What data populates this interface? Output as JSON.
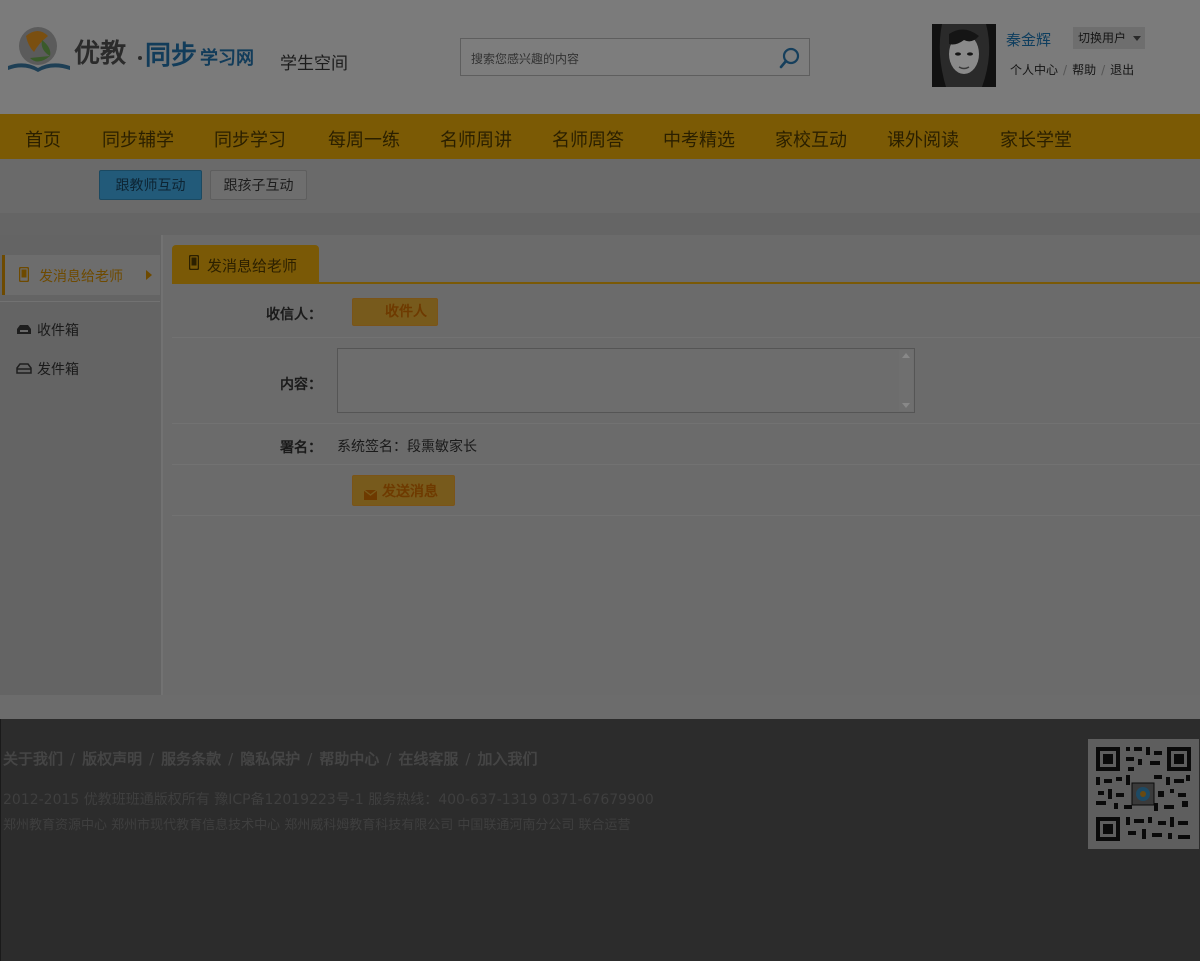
{
  "header": {
    "logo_text": "优教·同步学习网",
    "site_section": "学生空间",
    "search": {
      "placeholder": "搜索您感兴趣的内容",
      "button_icon": "search-icon"
    },
    "user": {
      "name": "秦金辉",
      "switch_label": "切换用户",
      "links": [
        "个人中心",
        "帮助",
        "退出"
      ]
    }
  },
  "nav": {
    "items": [
      "首页",
      "同步辅学",
      "同步学习",
      "每周一练",
      "名师周讲",
      "名师周答",
      "中考精选",
      "家校互动",
      "课外阅读",
      "家长学堂"
    ],
    "active_index": 7
  },
  "subnav": {
    "items": [
      "跟教师互动",
      "跟孩子互动"
    ],
    "active_index": 0
  },
  "sidebar": {
    "active_item": {
      "label": "发消息给老师",
      "icon": "phone-icon"
    },
    "items": [
      {
        "label": "收件箱",
        "icon": "inbox-icon"
      },
      {
        "label": "发件箱",
        "icon": "outbox-icon"
      }
    ]
  },
  "main": {
    "tab_label": "发消息给老师",
    "form": {
      "recipient_label": "收信人：",
      "recipient_button": "收件人",
      "content_label": "内容：",
      "content_value": "",
      "signature_label": "署名：",
      "signature_value": "系统签名：段熏敏家长",
      "send_button": "发送消息"
    }
  },
  "footer": {
    "links": [
      "关于我们",
      "版权声明",
      "服务条款",
      "隐私保护",
      "帮助中心",
      "在线客服",
      "加入我们"
    ],
    "copyright": "2012-2015 优教班班通版权所有  豫ICP备12019223号-1     服务热线：400-637-1319    0371-67679900",
    "operators": "郑州教育资源中心    郑州市现代教育信息技术中心   郑州威科姆教育科技有限公司 中国联通河南分公司  联合运营"
  },
  "colors": {
    "nav_bg": "#7b5a05",
    "accent_orange": "#6e4a00",
    "active_blue": "#225a79",
    "footer_bg": "#2c2c2c",
    "overlay_gray": "#6b6b6b"
  }
}
